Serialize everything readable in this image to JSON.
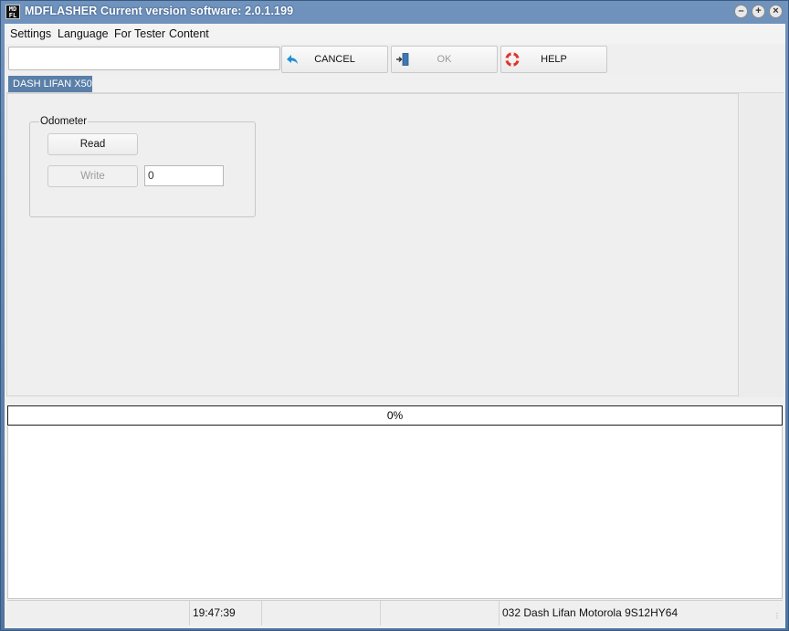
{
  "window": {
    "app_name": "MDFLASHER",
    "title_suffix": "Current version software: 2.0.1.199",
    "app_icon_text": "MD\nFL"
  },
  "menu": {
    "items": [
      "Settings",
      "Language",
      "For Tester",
      "Content"
    ]
  },
  "toolbar": {
    "combo_value": "",
    "cancel_label": "CANCEL",
    "ok_label": "OK",
    "help_label": "HELP"
  },
  "tabs": [
    {
      "label": "DASH LIFAN X50",
      "active": true
    }
  ],
  "odometer": {
    "group_label": "Odometer",
    "read_label": "Read",
    "write_label": "Write",
    "value": "0"
  },
  "progress": {
    "text": "0%",
    "fraction": 0
  },
  "status": {
    "cell1": "",
    "time": "19:47:39",
    "cell3": "",
    "cell4": "",
    "device": "032 Dash Lifan Motorola 9S12HY64"
  },
  "colors": {
    "title_bar": "#5a7fa8",
    "tab_active": "#5a7fa8",
    "cancel_icon": "#1e8fd6",
    "help_icon": "#e0342a"
  },
  "icons": {
    "cancel": "undo-arrow-icon",
    "ok": "enter-door-icon",
    "help": "lifebuoy-icon"
  }
}
